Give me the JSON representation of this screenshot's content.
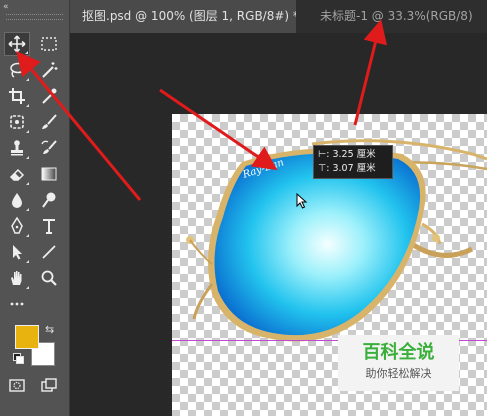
{
  "toolbar": {
    "collapse_label": "«",
    "tools": [
      {
        "name": "move-tool"
      },
      {
        "name": "marquee-tool"
      },
      {
        "name": "lasso-tool"
      },
      {
        "name": "magic-wand-tool"
      },
      {
        "name": "crop-tool"
      },
      {
        "name": "eyedropper-tool"
      },
      {
        "name": "healing-brush-tool"
      },
      {
        "name": "brush-tool"
      },
      {
        "name": "clone-stamp-tool"
      },
      {
        "name": "history-brush-tool"
      },
      {
        "name": "eraser-tool"
      },
      {
        "name": "gradient-tool"
      },
      {
        "name": "blur-tool"
      },
      {
        "name": "dodge-tool"
      },
      {
        "name": "pen-tool"
      },
      {
        "name": "type-tool"
      },
      {
        "name": "path-selection-tool"
      },
      {
        "name": "line-tool"
      },
      {
        "name": "hand-tool"
      },
      {
        "name": "zoom-tool"
      },
      {
        "name": "edit-toolbar"
      }
    ],
    "foreground_color": "#e8b20f",
    "background_color": "#ffffff"
  },
  "tabs": [
    {
      "label": "抠图.psd @ 100% (图层 1, RGB/8#) *",
      "close": "×",
      "active": true
    },
    {
      "label": "未标题-1 @ 33.3%(RGB/8)",
      "active": false
    }
  ],
  "canvas": {
    "tooltip": {
      "width_label": "⊢: 3.25 厘米",
      "height_label": "⊤: 3.07 厘米"
    },
    "brand_text": "Ray-Ban"
  },
  "watermark": {
    "title": "百科全说",
    "subtitle": "助你轻松解决"
  },
  "colors": {
    "arrow": "#e01b1b",
    "guide": "#c04ad0",
    "watermark_green": "#3aaf3a"
  }
}
